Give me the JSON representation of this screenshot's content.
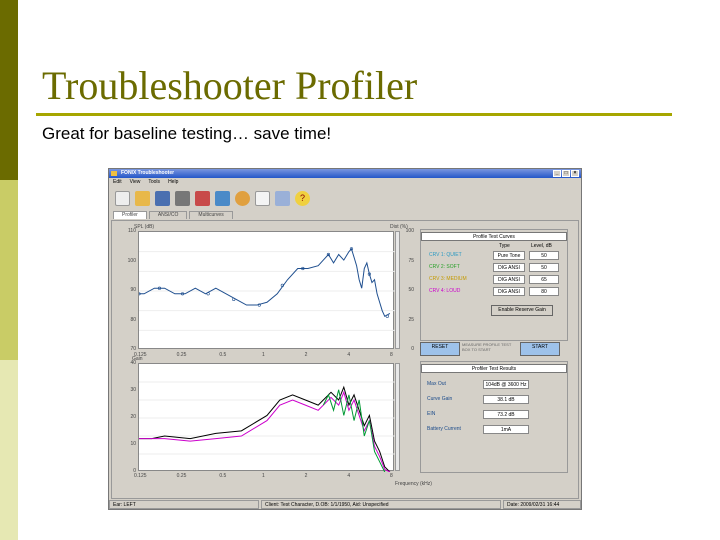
{
  "slide": {
    "title": "Troubleshooter Profiler",
    "subtitle": "Great for baseline testing… save time!"
  },
  "window": {
    "title": "FONIX Troubleshooter",
    "menus": [
      "Edit",
      "View",
      "Tools",
      "Help"
    ]
  },
  "toolbar": {
    "icons": [
      "new-icon",
      "open-icon",
      "save-icon",
      "print-icon",
      "export-icon",
      "settings-icon",
      "sound-icon",
      "notes-icon",
      "report-icon",
      "help-icon"
    ]
  },
  "tabs": [
    "Profiler",
    "ANSI/CO",
    "Multicurves"
  ],
  "top_chart": {
    "ylabel": "SPL (dB)",
    "yticks": [
      "110",
      "100",
      "90",
      "80",
      "70"
    ],
    "xticks": [
      "0.125",
      "0.25",
      "0.5",
      "1",
      "2",
      "4",
      "8"
    ],
    "right_label": "Dist (%)",
    "right_ticks": [
      "100",
      "75",
      "50",
      "25",
      "0"
    ],
    "curve": [
      [
        0,
        90
      ],
      [
        2,
        90
      ],
      [
        6,
        92
      ],
      [
        10,
        92
      ],
      [
        14,
        90
      ],
      [
        18,
        90
      ],
      [
        22,
        92
      ],
      [
        26,
        90
      ],
      [
        30,
        92
      ],
      [
        34,
        90
      ],
      [
        38,
        88
      ],
      [
        42,
        86
      ],
      [
        46,
        86
      ],
      [
        50,
        87
      ],
      [
        54,
        90
      ],
      [
        58,
        95
      ],
      [
        62,
        99
      ],
      [
        66,
        99
      ],
      [
        70,
        100
      ],
      [
        72,
        102
      ],
      [
        74,
        104
      ],
      [
        76,
        101
      ],
      [
        78,
        104
      ],
      [
        80,
        102
      ],
      [
        82,
        105
      ],
      [
        83,
        106
      ],
      [
        84,
        103
      ],
      [
        85,
        100
      ],
      [
        86,
        95
      ],
      [
        87,
        92
      ],
      [
        88,
        99
      ],
      [
        89,
        101
      ],
      [
        90,
        97
      ],
      [
        91,
        94
      ],
      [
        92,
        95
      ],
      [
        93,
        90
      ],
      [
        94,
        87
      ],
      [
        95,
        84
      ],
      [
        96,
        82
      ],
      [
        98,
        83
      ]
    ],
    "points": [
      [
        0,
        90
      ],
      [
        8,
        92
      ],
      [
        17,
        90
      ],
      [
        27,
        90
      ],
      [
        37,
        88
      ],
      [
        47,
        86
      ],
      [
        56,
        93
      ],
      [
        64,
        99
      ],
      [
        74,
        104
      ],
      [
        83,
        106
      ],
      [
        90,
        97
      ],
      [
        97,
        82
      ]
    ]
  },
  "bottom_chart": {
    "ylabel": "Gain",
    "yticks": [
      "40",
      "30",
      "20",
      "10",
      "0"
    ],
    "xticks": [
      "0.125",
      "0.25",
      "0.5",
      "1",
      "2",
      "4",
      "8"
    ],
    "xlabel": "Frequency (kHz)",
    "curves": [
      {
        "color": "#000000",
        "pts": [
          [
            0,
            13
          ],
          [
            5,
            13
          ],
          [
            10,
            14
          ],
          [
            20,
            13
          ],
          [
            30,
            15
          ],
          [
            40,
            16
          ],
          [
            50,
            22
          ],
          [
            55,
            28
          ],
          [
            60,
            30
          ],
          [
            65,
            28
          ],
          [
            70,
            26
          ],
          [
            75,
            31
          ],
          [
            78,
            28
          ],
          [
            80,
            33
          ],
          [
            82,
            26
          ],
          [
            84,
            30
          ],
          [
            86,
            24
          ],
          [
            88,
            18
          ],
          [
            90,
            22
          ],
          [
            92,
            12
          ],
          [
            94,
            8
          ],
          [
            96,
            2
          ],
          [
            98,
            0
          ]
        ]
      },
      {
        "color": "#cc00cc",
        "pts": [
          [
            0,
            13
          ],
          [
            5,
            13
          ],
          [
            10,
            13
          ],
          [
            20,
            12
          ],
          [
            30,
            13
          ],
          [
            40,
            14
          ],
          [
            50,
            20
          ],
          [
            55,
            26
          ],
          [
            60,
            28
          ],
          [
            65,
            26
          ],
          [
            70,
            24
          ],
          [
            75,
            29
          ],
          [
            78,
            26
          ],
          [
            80,
            31
          ],
          [
            82,
            24
          ],
          [
            84,
            28
          ],
          [
            86,
            22
          ],
          [
            88,
            16
          ],
          [
            90,
            20
          ],
          [
            92,
            10
          ],
          [
            94,
            6
          ],
          [
            96,
            1
          ],
          [
            98,
            0
          ]
        ]
      },
      {
        "color": "#009933",
        "pts": [
          [
            72,
            26
          ],
          [
            74,
            30
          ],
          [
            76,
            24
          ],
          [
            78,
            32
          ],
          [
            80,
            22
          ],
          [
            82,
            30
          ],
          [
            84,
            20
          ],
          [
            86,
            28
          ],
          [
            88,
            14
          ],
          [
            90,
            20
          ],
          [
            92,
            8
          ],
          [
            94,
            4
          ],
          [
            96,
            0
          ]
        ]
      }
    ]
  },
  "profile_test_curves": {
    "header": "Profile Test Curves",
    "col_type": "Type",
    "col_level": "Level, dB",
    "rows": [
      {
        "name": "CRV 1: QUIET",
        "color": "#2b9ac2",
        "type": "Pure Tone",
        "level": "50"
      },
      {
        "name": "CRV 2: SOFT",
        "color": "#28a028",
        "type": "DIG ANSI",
        "level": "50"
      },
      {
        "name": "CRV 3: MEDIUM",
        "color": "#c49a00",
        "type": "DIG ANSI",
        "level": "65"
      },
      {
        "name": "CRV 4: LOUD",
        "color": "#cc00cc",
        "type": "DIG ANSI",
        "level": "80"
      }
    ],
    "reserve_button": "Enable Reserve Gain",
    "reset_button": "RESET",
    "note": "MEASURE PROFILE TEST BOX TO START",
    "start_button": "START"
  },
  "profiler_results": {
    "header": "Profiler Test Results",
    "rows": [
      {
        "label": "Max Out",
        "value": "104dB @ 3600 Hz"
      },
      {
        "label": "Curve Gain",
        "value": "38.1 dB"
      },
      {
        "label": "EIN",
        "value": "73.2 dB"
      },
      {
        "label": "Battery Current",
        "value": "1mA"
      }
    ]
  },
  "statusbar": {
    "ear": "Ear: LEFT",
    "client": "Client: Test Character, D.OB: 1/1/1950, Aid: Unspecified",
    "date": "Date: 2009/02/31 16:44"
  },
  "colors": {
    "accent_dark": "#6b6b00",
    "accent_mid": "#c9cc66",
    "rule": "#a6a600"
  }
}
